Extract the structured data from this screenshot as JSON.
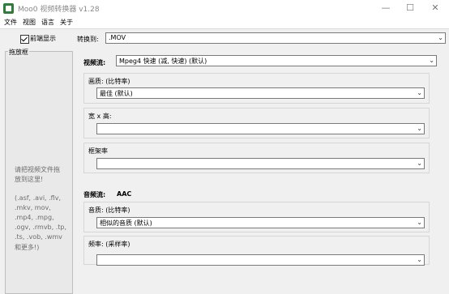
{
  "window": {
    "title": "Moo0 视频转换器 v1.28",
    "minimize": "—",
    "maximize": "☐",
    "close": "✕"
  },
  "menu": [
    "文件",
    "视图",
    "语言",
    "关于"
  ],
  "left": {
    "preview_label": "前端显示",
    "drop_title": "拖放框",
    "drop_lines": [
      "请把视频文件拖",
      "放到这里!",
      "(.asf, .avi, .flv,",
      ".mkv, mov,",
      ".mp4, .mpg,",
      ".ogv, .rmvb, .tp,",
      ".ts, .vob, .wmv",
      "和更多!)"
    ]
  },
  "convert": {
    "label": "转换到:",
    "value": ".MOV"
  },
  "video": {
    "label": "视频流:",
    "codec": "Mpeg4  快速      (减,   快速)  (默认)",
    "quality": {
      "label": "画质:",
      "hint": "(比特率)",
      "value": "最佳 (默认)"
    },
    "size": {
      "label": "宽 x 高:",
      "value": ""
    },
    "framerate": {
      "label": "框架率",
      "value": ""
    }
  },
  "audio": {
    "label": "音频流:",
    "codec": "AAC",
    "quality": {
      "label": "音质:",
      "hint": "(比特率)",
      "value": "相似的音质  (默认)"
    },
    "frequency": {
      "label": "频率:",
      "hint": "(采样率)",
      "value": ""
    }
  }
}
